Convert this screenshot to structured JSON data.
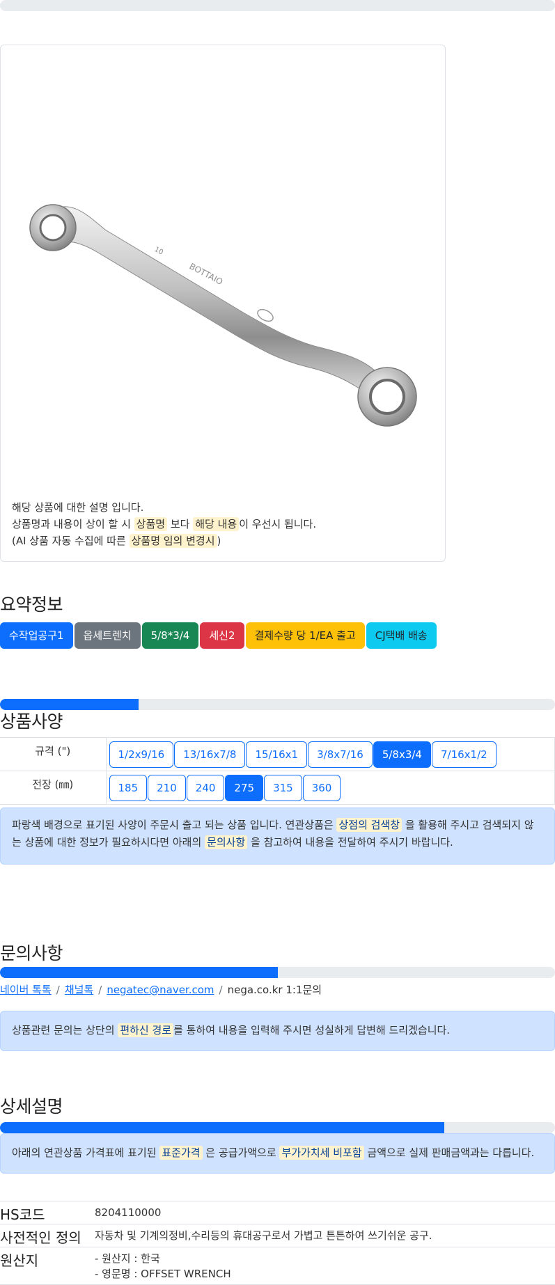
{
  "product_card": {
    "image_alt": "wrench",
    "description_lines": {
      "line1": "해당 상품에 대한 설명 입니다.",
      "line2_a": "상품명과 내용이 상이 할 시",
      "line2_hl1": "상품명",
      "line2_b": "보다",
      "line2_hl2": "해당 내용",
      "line2_c": "이 우선시 됩니다.",
      "line3_a": "(AI 상품 자동 수집에 따른",
      "line3_hl": "상품명 임의 변경시",
      "line3_b": ")"
    }
  },
  "summary": {
    "title": "요약정보",
    "badges": [
      {
        "label": "수작업공구1",
        "color": "#0d6efd"
      },
      {
        "label": "옵세트렌치",
        "color": "#6c757d"
      },
      {
        "label": "5/8*3/4",
        "color": "#198754"
      },
      {
        "label": "세신2",
        "color": "#dc3545"
      },
      {
        "label": "결제수량 당 1/EA 출고",
        "color": "#ffc107"
      },
      {
        "label": "CJ택배 배송",
        "color": "#0dcaf0"
      }
    ]
  },
  "spec": {
    "progress": 25,
    "title": "상품사양",
    "rows": [
      {
        "head": "규격 (\")",
        "options": [
          "1/2x9/16",
          "13/16x7/8",
          "15/16x1",
          "3/8x7/16",
          "5/8x3/4",
          "7/16x1/2"
        ],
        "active": "5/8x3/4"
      },
      {
        "head": "전장 (㎜)",
        "options": [
          "185",
          "210",
          "240",
          "275",
          "315",
          "360"
        ],
        "active": "275"
      }
    ],
    "notice": {
      "a": "파랑색 배경으로 표기된 사양이 주문시 출고 되는 상품 입니다. 연관상품은",
      "hl1": "상점의 검색창",
      "b": "을 활용해 주시고 검색되지 않는 상품에 대한 정보가 필요하시다면 아래의",
      "hl2": "문의사항",
      "c": "을 참고하여 내용을 전달하여 주시기 바랍니다."
    }
  },
  "inquiry": {
    "title": "문의사항",
    "progress": 50,
    "links": [
      "네이버 톡톡",
      "채널톡",
      "negatec@naver.com"
    ],
    "plain": "nega.co.kr 1:1문의",
    "separator": "/",
    "notice": {
      "a": "상품관련 문의는 상단의",
      "hl": "편하신 경로",
      "b": "를 통하여 내용을 입력해 주시면 성실하게 답변해 드리겠습니다."
    }
  },
  "detail": {
    "title": "상세설명",
    "progress": 80,
    "notice": {
      "a": "아래의 연관상품 가격표에 표기된",
      "hl1": "표준가격",
      "b": "은 공급가액으로",
      "hl2": "부가가치세 비포함",
      "c": "금액으로 실제 판매금액과는 다릅니다."
    },
    "info": [
      {
        "label": "HS코드",
        "value": "8204110000"
      },
      {
        "label": "사전적인 정의",
        "value": "자동차 및 기계의정비,수리등의 휴대공구로서 가볍고 튼튼하여 쓰기쉬운 공구."
      },
      {
        "label": "원산지",
        "value1": "- 원산지 : 한국",
        "value2": "- 영문명 : OFFSET WRENCH"
      }
    ]
  }
}
